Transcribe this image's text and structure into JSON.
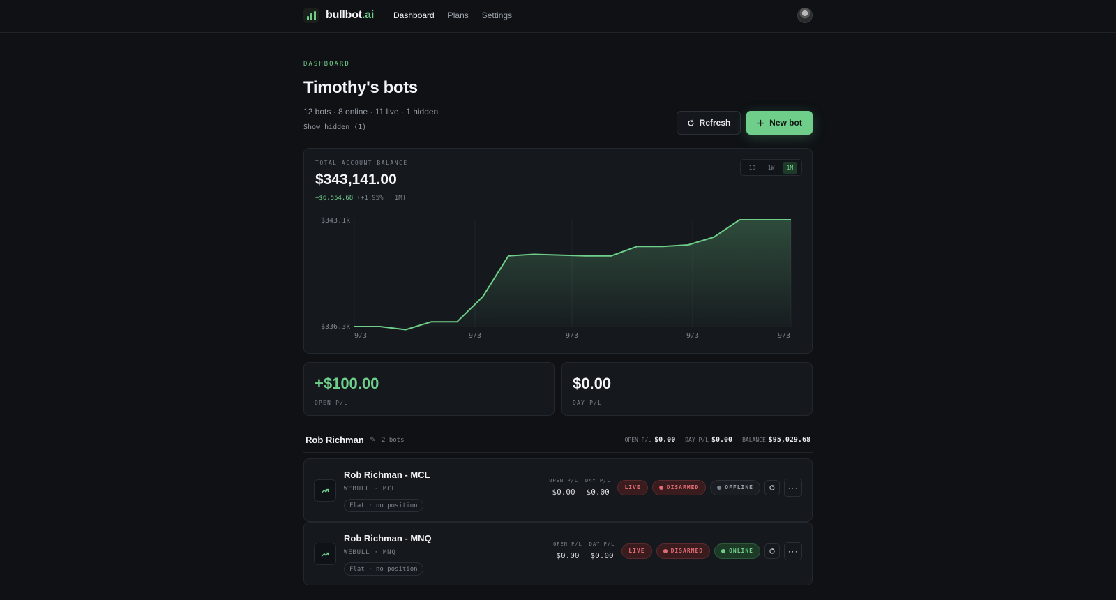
{
  "nav": {
    "brand_main": "bullbot",
    "brand_suffix": ".ai",
    "links": [
      "Dashboard",
      "Plans",
      "Settings"
    ]
  },
  "header": {
    "eyebrow": "DASHBOARD",
    "title": "Timothy's bots",
    "subtitle": "12 bots · 8 online · 11 live · 1 hidden",
    "show_hidden": "Show hidden (1)",
    "refresh_label": "Refresh",
    "new_bot_label": "New bot"
  },
  "balance": {
    "label": "TOTAL ACCOUNT BALANCE",
    "value": "$343,141.00",
    "change": "+$6,554.68",
    "change_suffix": "(+1.95% · 1M)",
    "ranges": [
      "1D",
      "1W",
      "1M"
    ],
    "active_range": "1M"
  },
  "chart_data": {
    "type": "area",
    "y_tick_labels": [
      "$343.1k",
      "$336.3k"
    ],
    "ylim": [
      336.3,
      343.1
    ],
    "x_tick_labels": [
      "9/3",
      "9/3",
      "9/3",
      "9/3",
      "9/3"
    ],
    "values": [
      336.3,
      336.3,
      336.1,
      336.6,
      336.6,
      338.2,
      340.8,
      340.9,
      340.85,
      340.8,
      340.8,
      341.4,
      341.4,
      341.5,
      342.0,
      343.1,
      343.1,
      343.1
    ],
    "grid": true,
    "colors": {
      "line": "#6fcf8a"
    }
  },
  "summary": {
    "open_pl": {
      "value": "+$100.00",
      "label": "OPEN P/L"
    },
    "day_pl": {
      "value": "$0.00",
      "label": "DAY P/L"
    }
  },
  "group": {
    "name": "Rob Richman",
    "count": "2 bots",
    "open_pl_label": "OPEN P/L",
    "open_pl": "$0.00",
    "day_pl_label": "DAY P/L",
    "day_pl": "$0.00",
    "balance_label": "BALANCE",
    "balance": "$95,029.68"
  },
  "bots": [
    {
      "name": "Rob Richman - MCL",
      "broker": "WEBULL",
      "symbol": "MCL",
      "position": "Flat · no position",
      "open_pl_label": "OPEN P/L",
      "open_pl": "$0.00",
      "day_pl_label": "DAY P/L",
      "day_pl": "$0.00",
      "mode": "LIVE",
      "arm": "DISARMED",
      "status": "OFFLINE"
    },
    {
      "name": "Rob Richman - MNQ",
      "broker": "WEBULL",
      "symbol": "MNQ",
      "position": "Flat · no position",
      "open_pl_label": "OPEN P/L",
      "open_pl": "$0.00",
      "day_pl_label": "DAY P/L",
      "day_pl": "$0.00",
      "mode": "LIVE",
      "arm": "DISARMED",
      "status": "ONLINE"
    }
  ]
}
